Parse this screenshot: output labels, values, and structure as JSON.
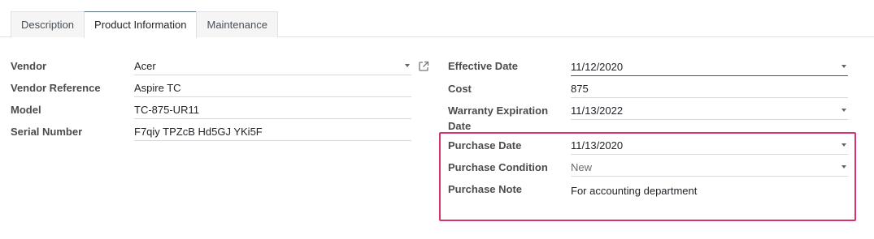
{
  "tabs": [
    {
      "label": "Description",
      "active": false
    },
    {
      "label": "Product Information",
      "active": true
    },
    {
      "label": "Maintenance",
      "active": false
    }
  ],
  "left": {
    "vendor_label": "Vendor",
    "vendor_value": "Acer",
    "vendor_ref_label": "Vendor Reference",
    "vendor_ref_value": "Aspire TC",
    "model_label": "Model",
    "model_value": "TC-875-UR11",
    "serial_label": "Serial Number",
    "serial_value": "F7qiy TPZcB Hd5GJ YKi5F"
  },
  "right": {
    "effective_date_label": "Effective Date",
    "effective_date_value": "11/12/2020",
    "cost_label": "Cost",
    "cost_value": "875",
    "warranty_label_line1": "Warranty Expiration",
    "warranty_label_line2": "Date",
    "warranty_value": "11/13/2022",
    "purchase_date_label": "Purchase Date",
    "purchase_date_value": "11/13/2020",
    "purchase_condition_label": "Purchase Condition",
    "purchase_condition_value": "New",
    "purchase_note_label": "Purchase Note",
    "purchase_note_value": "For accounting department"
  },
  "icons": {
    "vendor_external": "external-link-icon",
    "dropdown": "caret-down-icon"
  },
  "colors": {
    "highlight": "#d6336c",
    "active_tab_top": "#5a6d7a"
  }
}
